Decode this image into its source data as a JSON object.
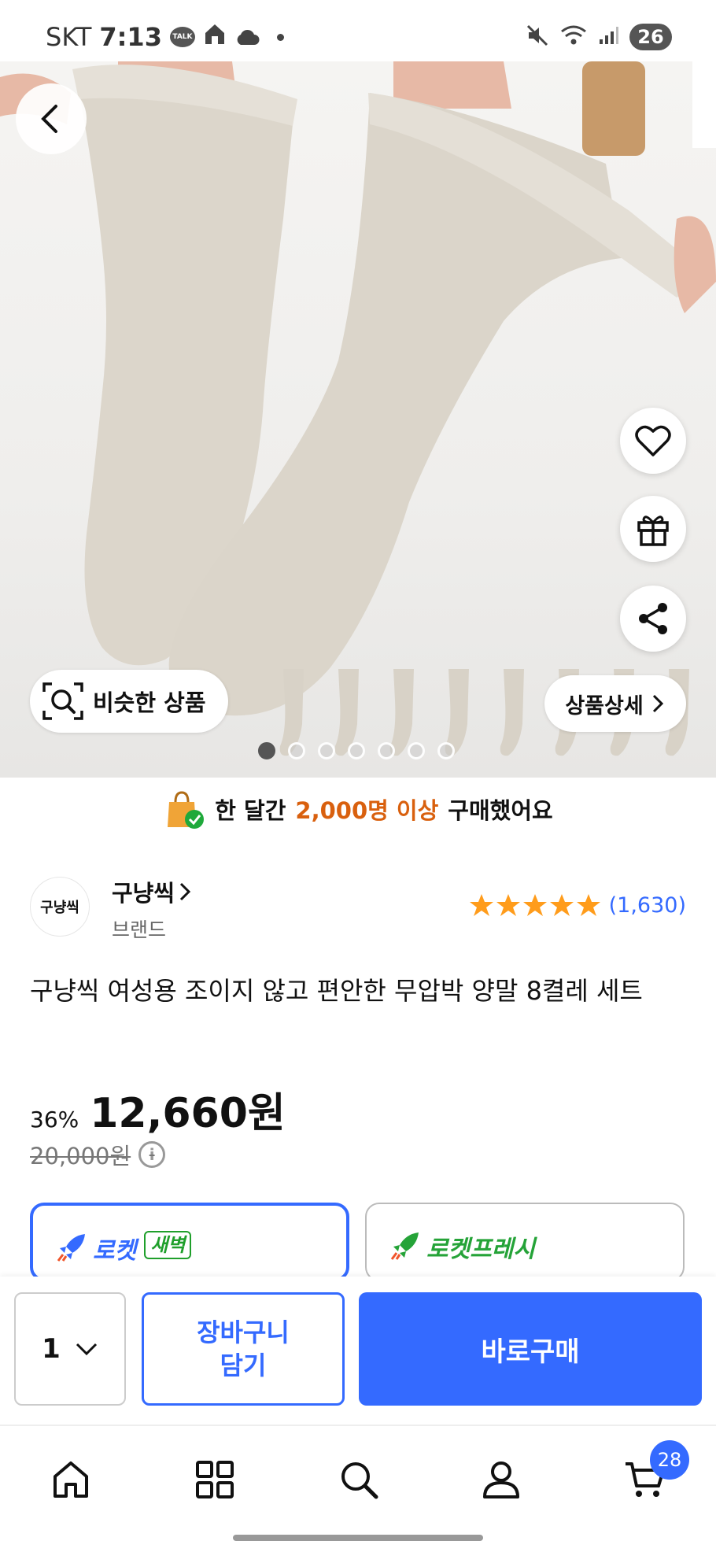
{
  "status_bar": {
    "carrier": "SKT",
    "time": "7:13",
    "talk_label": "TALK",
    "battery": "26"
  },
  "hero": {
    "similar_label": "비슷한 상품",
    "detail_label": "상품상세",
    "page_count": 7,
    "active_page": 0
  },
  "banner": {
    "prefix": "한 달간",
    "highlight": "2,000명 이상",
    "suffix": "구매했어요"
  },
  "brand": {
    "logo_text": "구냥씩",
    "name": "구냥씩",
    "subtitle": "브랜드",
    "rating": 5,
    "review_count": "(1,630)"
  },
  "product": {
    "title": "구냥씩 여성용 조이지 않고 편안한 무압박 양말 8켤레 세트",
    "discount": "36%",
    "price": "12,660원",
    "original_price": "20,000원"
  },
  "delivery": {
    "option1": "로켓",
    "option1_tag": "새벽",
    "option2": "로켓프레시"
  },
  "action_bar": {
    "quantity": "1",
    "cart_label_line1": "장바구니",
    "cart_label_line2": "담기",
    "buy_label": "바로구매"
  },
  "bottom_nav": {
    "cart_badge": "28"
  },
  "colors": {
    "accent": "#346aff",
    "highlight": "#d9600e",
    "star": "#ff9c1b"
  }
}
